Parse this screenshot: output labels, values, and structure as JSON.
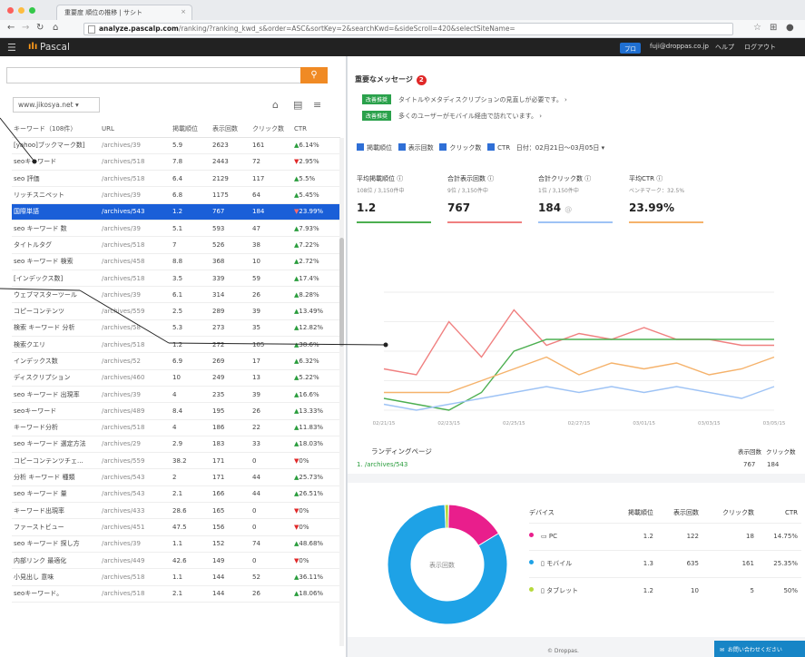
{
  "browser": {
    "tab_title": "重要度 順位の推移 | サシト",
    "tab_close": "×",
    "url_host": "analyze.pascalp.com",
    "url_path": "/ranking/?ranking_kwd_s&order=ASC&sortKey=2&searchKwd=&sideScroll=420&selectSiteName="
  },
  "app": {
    "logo": "Pascal",
    "plan_badge": "プロ",
    "user_email": "fuji@droppas.co.jp",
    "help": "ヘルプ",
    "logout": "ログアウト"
  },
  "left": {
    "search_placeholder": "",
    "site": "www.jikosya.net ▾",
    "columns": [
      "キーワード（108件）",
      "URL",
      "掲載順位",
      "表示回数",
      "クリック数",
      "CTR"
    ],
    "rows": [
      {
        "kw": "[yahoo]ブックマーク数]",
        "url": "/archives/39",
        "rank": "5.9",
        "imp": "2623",
        "clk": "161",
        "ctr": "6.14%",
        "dir": "up"
      },
      {
        "kw": "seoキーワード",
        "url": "/archives/518",
        "rank": "7.8",
        "imp": "2443",
        "clk": "72",
        "ctr": "2.95%",
        "dir": "dn"
      },
      {
        "kw": "seo 評価",
        "url": "/archives/518",
        "rank": "6.4",
        "imp": "2129",
        "clk": "117",
        "ctr": "5.5%",
        "dir": "up"
      },
      {
        "kw": "リッチスニペット",
        "url": "/archives/39",
        "rank": "6.8",
        "imp": "1175",
        "clk": "64",
        "ctr": "5.45%",
        "dir": "up"
      },
      {
        "kw": "国際単語",
        "url": "/archives/543",
        "rank": "1.2",
        "imp": "767",
        "clk": "184",
        "ctr": "23.99%",
        "dir": "dn",
        "selected": true
      },
      {
        "kw": "seo キーワード 数",
        "url": "/archives/39",
        "rank": "5.1",
        "imp": "593",
        "clk": "47",
        "ctr": "7.93%",
        "dir": "up"
      },
      {
        "kw": "タイトルタグ",
        "url": "/archives/518",
        "rank": "7",
        "imp": "526",
        "clk": "38",
        "ctr": "7.22%",
        "dir": "up"
      },
      {
        "kw": "seo キーワード 検索",
        "url": "/archives/458",
        "rank": "8.8",
        "imp": "368",
        "clk": "10",
        "ctr": "2.72%",
        "dir": "up"
      },
      {
        "kw": "[インデックス数]",
        "url": "/archives/518",
        "rank": "3.5",
        "imp": "339",
        "clk": "59",
        "ctr": "17.4%",
        "dir": "up"
      },
      {
        "kw": "ウェブマスターツール",
        "url": "/archives/39",
        "rank": "6.1",
        "imp": "314",
        "clk": "26",
        "ctr": "8.28%",
        "dir": "up"
      },
      {
        "kw": "コピーコンテンツ",
        "url": "/archives/559",
        "rank": "2.5",
        "imp": "289",
        "clk": "39",
        "ctr": "13.49%",
        "dir": "up"
      },
      {
        "kw": "検索 キーワード 分析",
        "url": "/archives/58",
        "rank": "5.3",
        "imp": "273",
        "clk": "35",
        "ctr": "12.82%",
        "dir": "up"
      },
      {
        "kw": "検索クエリ",
        "url": "/archives/518",
        "rank": "1.2",
        "imp": "272",
        "clk": "105",
        "ctr": "38.6%",
        "dir": "up"
      },
      {
        "kw": "インデックス数",
        "url": "/archives/52",
        "rank": "6.9",
        "imp": "269",
        "clk": "17",
        "ctr": "6.32%",
        "dir": "up"
      },
      {
        "kw": "ディスクリプション",
        "url": "/archives/460",
        "rank": "10",
        "imp": "249",
        "clk": "13",
        "ctr": "5.22%",
        "dir": "up"
      },
      {
        "kw": "seo キーワード 出現率",
        "url": "/archives/39",
        "rank": "4",
        "imp": "235",
        "clk": "39",
        "ctr": "16.6%",
        "dir": "up"
      },
      {
        "kw": "seoキーワード",
        "url": "/archives/489",
        "rank": "8.4",
        "imp": "195",
        "clk": "26",
        "ctr": "13.33%",
        "dir": "up"
      },
      {
        "kw": "キーワード分析",
        "url": "/archives/518",
        "rank": "4",
        "imp": "186",
        "clk": "22",
        "ctr": "11.83%",
        "dir": "up"
      },
      {
        "kw": "seo キーワード 選定方法",
        "url": "/archives/29",
        "rank": "2.9",
        "imp": "183",
        "clk": "33",
        "ctr": "18.03%",
        "dir": "up"
      },
      {
        "kw": "コピーコンテンツチェ...",
        "url": "/archives/559",
        "rank": "38.2",
        "imp": "171",
        "clk": "0",
        "ctr": "0%",
        "dir": "dn"
      },
      {
        "kw": "分析 キーワード 種類",
        "url": "/archives/543",
        "rank": "2",
        "imp": "171",
        "clk": "44",
        "ctr": "25.73%",
        "dir": "up"
      },
      {
        "kw": "seo キーワード 量",
        "url": "/archives/543",
        "rank": "2.1",
        "imp": "166",
        "clk": "44",
        "ctr": "26.51%",
        "dir": "up"
      },
      {
        "kw": "キーワード出現率",
        "url": "/archives/433",
        "rank": "28.6",
        "imp": "165",
        "clk": "0",
        "ctr": "0%",
        "dir": "dn"
      },
      {
        "kw": "ファーストビュー",
        "url": "/archives/451",
        "rank": "47.5",
        "imp": "156",
        "clk": "0",
        "ctr": "0%",
        "dir": "dn"
      },
      {
        "kw": "seo キーワード 探し方",
        "url": "/archives/39",
        "rank": "1.1",
        "imp": "152",
        "clk": "74",
        "ctr": "48.68%",
        "dir": "up"
      },
      {
        "kw": "内部リンク 最適化",
        "url": "/archives/449",
        "rank": "42.6",
        "imp": "149",
        "clk": "0",
        "ctr": "0%",
        "dir": "dn"
      },
      {
        "kw": "小見出し 意味",
        "url": "/archives/518",
        "rank": "1.1",
        "imp": "144",
        "clk": "52",
        "ctr": "36.11%",
        "dir": "up"
      },
      {
        "kw": "seoキーワード。",
        "url": "/archives/518",
        "rank": "2.1",
        "imp": "144",
        "clk": "26",
        "ctr": "18.06%",
        "dir": "up"
      }
    ]
  },
  "right": {
    "messages_title": "重要なメッセージ",
    "messages_count": "2",
    "messages": [
      {
        "tag": "改善推奨",
        "text": "タイトルやメタディスクリプションの見直しが必要です。 ›"
      },
      {
        "tag": "改善推奨",
        "text": "多くのユーザーがモバイル経由で訪れています。 ›"
      }
    ],
    "filters": [
      "掲載順位",
      "表示回数",
      "クリック数",
      "CTR"
    ],
    "date_range": "日付：02月21日〜03月05日 ▾",
    "metrics": [
      {
        "label": "平均掲載順位 ⓘ",
        "sub": "108位 / 3,150件中",
        "value": "1.2",
        "color": "#4caf50"
      },
      {
        "label": "合計表示回数 ⓘ",
        "sub": "9位 / 3,150件中",
        "value": "767",
        "color": "#f08080"
      },
      {
        "label": "合計クリック数 ⓘ",
        "sub": "1位 / 3,150件中",
        "value": "184",
        "unit": "@",
        "color": "#9ec3f5"
      },
      {
        "label": "平均CTR ⓘ",
        "sub": "ベンチマーク：32.5%",
        "value": "23.99%",
        "color": "#f5b26b"
      }
    ],
    "landing": {
      "title": "ランディングページ",
      "col1": "表示回数",
      "col2": "クリック数",
      "url": "1.  /archives/543",
      "imp": "767",
      "clk": "184"
    },
    "donut_label": "表示回数",
    "device_table": {
      "headers": [
        "デバイス",
        "掲載順位",
        "表示回数",
        "クリック数",
        "CTR"
      ],
      "rows": [
        {
          "name": "PC",
          "color": "#e91e8c",
          "rank": "1.2",
          "imp": "122",
          "clk": "18",
          "ctr": "14.75%"
        },
        {
          "name": "モバイル",
          "color": "#1ea2e6",
          "rank": "1.3",
          "imp": "635",
          "clk": "161",
          "ctr": "25.35%"
        },
        {
          "name": "タブレット",
          "color": "#b6d93c",
          "rank": "1.2",
          "imp": "10",
          "clk": "5",
          "ctr": "50%"
        }
      ]
    },
    "footer": "© Droppas.",
    "contact": "お問い合わせください"
  },
  "chart_data": [
    {
      "type": "line",
      "x": [
        "02/21/15",
        "02/23/15",
        "02/25/15",
        "02/27/15",
        "03/01/15",
        "03/03/15",
        "03/05/15"
      ],
      "series": [
        {
          "color": "#f08080",
          "values": [
            0.35,
            0.3,
            0.75,
            0.45,
            0.85,
            0.55,
            0.65,
            0.6,
            0.7,
            0.6,
            0.6,
            0.55,
            0.55
          ]
        },
        {
          "color": "#4caf50",
          "values": [
            0.1,
            0.05,
            0.0,
            0.15,
            0.5,
            0.6,
            0.6,
            0.6,
            0.6,
            0.6,
            0.6,
            0.6,
            0.6
          ]
        },
        {
          "color": "#f5b26b",
          "values": [
            0.15,
            0.15,
            0.15,
            0.25,
            0.35,
            0.45,
            0.3,
            0.4,
            0.35,
            0.4,
            0.3,
            0.35,
            0.45
          ]
        },
        {
          "color": "#9ec3f5",
          "values": [
            0.05,
            0.0,
            0.05,
            0.1,
            0.15,
            0.2,
            0.15,
            0.2,
            0.15,
            0.2,
            0.15,
            0.1,
            0.2
          ]
        }
      ]
    },
    {
      "type": "pie",
      "values": [
        16,
        83,
        1
      ],
      "categories": [
        "PC",
        "モバイル",
        "タブレット"
      ],
      "colors": [
        "#e91e8c",
        "#1ea2e6",
        "#b6d93c"
      ]
    }
  ]
}
